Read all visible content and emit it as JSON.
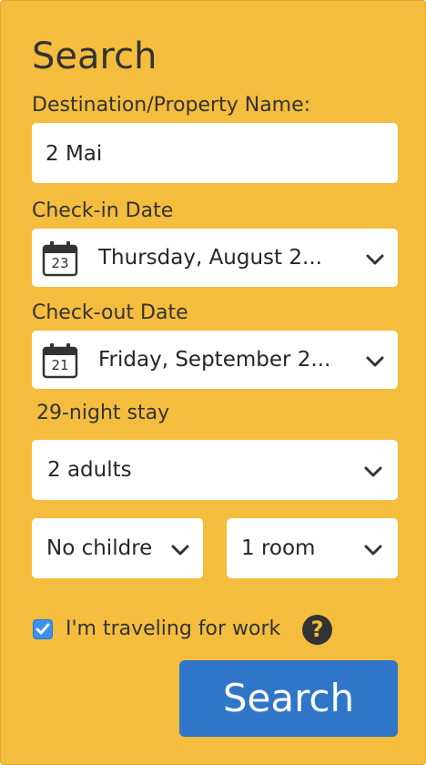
{
  "form": {
    "title": "Search",
    "destination": {
      "label": "Destination/Property Name:",
      "value": "2 Mai"
    },
    "checkin": {
      "label": "Check-in Date",
      "calendar_day": "23",
      "value": "Thursday, August 2..."
    },
    "checkout": {
      "label": "Check-out Date",
      "calendar_day": "21",
      "value": "Friday, September 2..."
    },
    "stay_length": "29-night stay",
    "adults": "2 adults",
    "children": "No childre",
    "rooms": "1 room",
    "work_travel": {
      "label": "I'm traveling for work",
      "checked": true,
      "help_icon": "question-circle-icon"
    },
    "submit_label": "Search"
  },
  "colors": {
    "panel_bg": "#f4bd3e",
    "button_bg": "#2f76c9",
    "checkbox_bg": "#3b8ff0",
    "text": "#333333"
  }
}
